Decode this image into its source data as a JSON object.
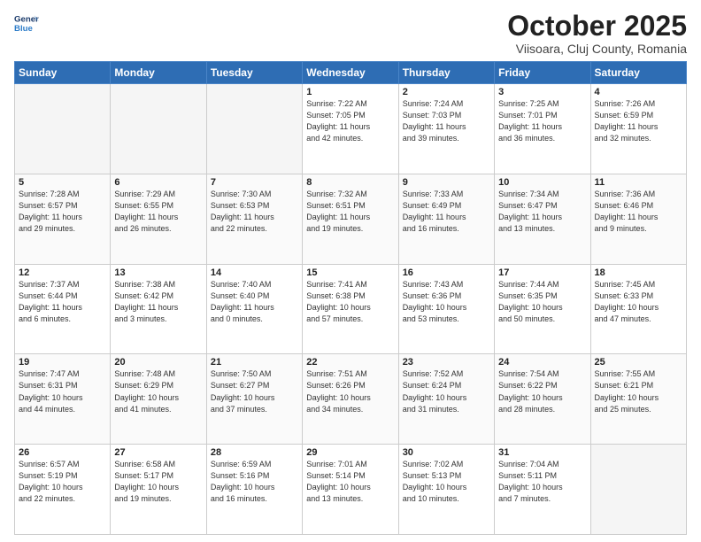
{
  "header": {
    "logo_line1": "General",
    "logo_line2": "Blue",
    "month": "October 2025",
    "location": "Viisoara, Cluj County, Romania"
  },
  "weekdays": [
    "Sunday",
    "Monday",
    "Tuesday",
    "Wednesday",
    "Thursday",
    "Friday",
    "Saturday"
  ],
  "weeks": [
    [
      {
        "day": "",
        "info": ""
      },
      {
        "day": "",
        "info": ""
      },
      {
        "day": "",
        "info": ""
      },
      {
        "day": "1",
        "info": "Sunrise: 7:22 AM\nSunset: 7:05 PM\nDaylight: 11 hours\nand 42 minutes."
      },
      {
        "day": "2",
        "info": "Sunrise: 7:24 AM\nSunset: 7:03 PM\nDaylight: 11 hours\nand 39 minutes."
      },
      {
        "day": "3",
        "info": "Sunrise: 7:25 AM\nSunset: 7:01 PM\nDaylight: 11 hours\nand 36 minutes."
      },
      {
        "day": "4",
        "info": "Sunrise: 7:26 AM\nSunset: 6:59 PM\nDaylight: 11 hours\nand 32 minutes."
      }
    ],
    [
      {
        "day": "5",
        "info": "Sunrise: 7:28 AM\nSunset: 6:57 PM\nDaylight: 11 hours\nand 29 minutes."
      },
      {
        "day": "6",
        "info": "Sunrise: 7:29 AM\nSunset: 6:55 PM\nDaylight: 11 hours\nand 26 minutes."
      },
      {
        "day": "7",
        "info": "Sunrise: 7:30 AM\nSunset: 6:53 PM\nDaylight: 11 hours\nand 22 minutes."
      },
      {
        "day": "8",
        "info": "Sunrise: 7:32 AM\nSunset: 6:51 PM\nDaylight: 11 hours\nand 19 minutes."
      },
      {
        "day": "9",
        "info": "Sunrise: 7:33 AM\nSunset: 6:49 PM\nDaylight: 11 hours\nand 16 minutes."
      },
      {
        "day": "10",
        "info": "Sunrise: 7:34 AM\nSunset: 6:47 PM\nDaylight: 11 hours\nand 13 minutes."
      },
      {
        "day": "11",
        "info": "Sunrise: 7:36 AM\nSunset: 6:46 PM\nDaylight: 11 hours\nand 9 minutes."
      }
    ],
    [
      {
        "day": "12",
        "info": "Sunrise: 7:37 AM\nSunset: 6:44 PM\nDaylight: 11 hours\nand 6 minutes."
      },
      {
        "day": "13",
        "info": "Sunrise: 7:38 AM\nSunset: 6:42 PM\nDaylight: 11 hours\nand 3 minutes."
      },
      {
        "day": "14",
        "info": "Sunrise: 7:40 AM\nSunset: 6:40 PM\nDaylight: 11 hours\nand 0 minutes."
      },
      {
        "day": "15",
        "info": "Sunrise: 7:41 AM\nSunset: 6:38 PM\nDaylight: 10 hours\nand 57 minutes."
      },
      {
        "day": "16",
        "info": "Sunrise: 7:43 AM\nSunset: 6:36 PM\nDaylight: 10 hours\nand 53 minutes."
      },
      {
        "day": "17",
        "info": "Sunrise: 7:44 AM\nSunset: 6:35 PM\nDaylight: 10 hours\nand 50 minutes."
      },
      {
        "day": "18",
        "info": "Sunrise: 7:45 AM\nSunset: 6:33 PM\nDaylight: 10 hours\nand 47 minutes."
      }
    ],
    [
      {
        "day": "19",
        "info": "Sunrise: 7:47 AM\nSunset: 6:31 PM\nDaylight: 10 hours\nand 44 minutes."
      },
      {
        "day": "20",
        "info": "Sunrise: 7:48 AM\nSunset: 6:29 PM\nDaylight: 10 hours\nand 41 minutes."
      },
      {
        "day": "21",
        "info": "Sunrise: 7:50 AM\nSunset: 6:27 PM\nDaylight: 10 hours\nand 37 minutes."
      },
      {
        "day": "22",
        "info": "Sunrise: 7:51 AM\nSunset: 6:26 PM\nDaylight: 10 hours\nand 34 minutes."
      },
      {
        "day": "23",
        "info": "Sunrise: 7:52 AM\nSunset: 6:24 PM\nDaylight: 10 hours\nand 31 minutes."
      },
      {
        "day": "24",
        "info": "Sunrise: 7:54 AM\nSunset: 6:22 PM\nDaylight: 10 hours\nand 28 minutes."
      },
      {
        "day": "25",
        "info": "Sunrise: 7:55 AM\nSunset: 6:21 PM\nDaylight: 10 hours\nand 25 minutes."
      }
    ],
    [
      {
        "day": "26",
        "info": "Sunrise: 6:57 AM\nSunset: 5:19 PM\nDaylight: 10 hours\nand 22 minutes."
      },
      {
        "day": "27",
        "info": "Sunrise: 6:58 AM\nSunset: 5:17 PM\nDaylight: 10 hours\nand 19 minutes."
      },
      {
        "day": "28",
        "info": "Sunrise: 6:59 AM\nSunset: 5:16 PM\nDaylight: 10 hours\nand 16 minutes."
      },
      {
        "day": "29",
        "info": "Sunrise: 7:01 AM\nSunset: 5:14 PM\nDaylight: 10 hours\nand 13 minutes."
      },
      {
        "day": "30",
        "info": "Sunrise: 7:02 AM\nSunset: 5:13 PM\nDaylight: 10 hours\nand 10 minutes."
      },
      {
        "day": "31",
        "info": "Sunrise: 7:04 AM\nSunset: 5:11 PM\nDaylight: 10 hours\nand 7 minutes."
      },
      {
        "day": "",
        "info": ""
      }
    ]
  ]
}
